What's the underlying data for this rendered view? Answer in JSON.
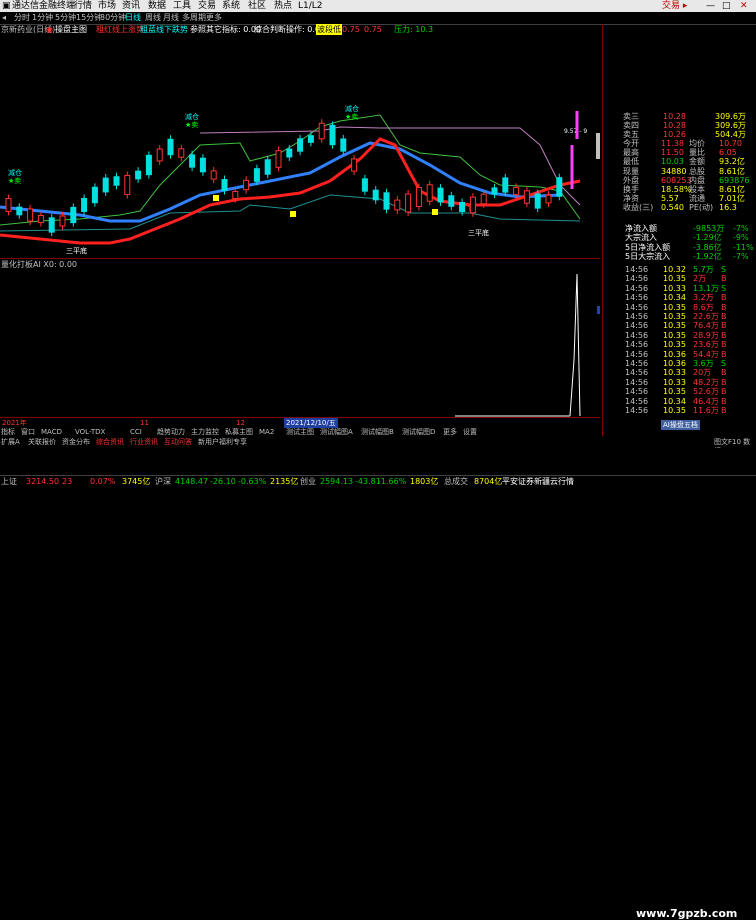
{
  "menu": {
    "app_title": "通达信金融终端",
    "items": [
      "行情",
      "市场",
      "资讯",
      "数据",
      "工具",
      "交易",
      "系统",
      "社区",
      "热点",
      "L1/L2"
    ],
    "broker": "交易 ▸"
  },
  "toolbar": {
    "periods": [
      "分时",
      "1分钟",
      "5分钟",
      "15分钟",
      "30分钟",
      "日线",
      "周线",
      "月线",
      "多周期",
      "更多"
    ]
  },
  "infobar": {
    "stock_name": "京新药业(日线)",
    "main_label": "操盘主图",
    "items": [
      "粗红线上涨势",
      "粗蓝线下跌势",
      "参照其它指标: 0.00",
      "综合判断操作: 0.00",
      "波段低",
      "0.75",
      "0.75",
      "压力: 10.3"
    ]
  },
  "chart": {
    "annotations": [
      "减仓",
      "★卖",
      "减仓",
      "★卖",
      "减仓",
      "★卖",
      "三平底",
      "三平底"
    ],
    "price_label": "9.57 - 9"
  },
  "indicator": {
    "label": "量化打板AI  X0: 0.00"
  },
  "quote": {
    "asks": [
      {
        "label": "卖三",
        "price": "10.28",
        "vol": "309.6万"
      },
      {
        "label": "卖四",
        "price": "10.28",
        "vol": "309.6万"
      },
      {
        "label": "卖五",
        "price": "10.26",
        "vol": "504.4万"
      }
    ],
    "stats": [
      {
        "l1": "今开",
        "v1": "11.38",
        "l2": "均价",
        "v2": "10.70"
      },
      {
        "l1": "最高",
        "v1": "11.50",
        "l2": "量比",
        "v2": "6.05"
      },
      {
        "l1": "最低",
        "v1": "10.03",
        "l2": "金额",
        "v2": "93.2亿"
      },
      {
        "l1": "现量",
        "v1": "34880",
        "l2": "总股",
        "v2": "8.61亿"
      },
      {
        "l1": "外盘",
        "v1": "608253",
        "l2": "内盘",
        "v2": "693876"
      },
      {
        "l1": "换手",
        "v1": "18.58%",
        "l2": "股本",
        "v2": "8.61亿"
      },
      {
        "l1": "净资",
        "v1": "5.57",
        "l2": "流通",
        "v2": "7.01亿"
      },
      {
        "l1": "收益(三)",
        "v1": "0.540",
        "l2": "PE(动)",
        "v2": "16.3"
      }
    ],
    "flows": [
      {
        "label": "净流入额",
        "value": "-9853万",
        "pct": "-7%"
      },
      {
        "label": "大宗流入",
        "value": "-1.29亿",
        "pct": "-9%"
      },
      {
        "label": "5日净流入额",
        "value": "-3.86亿",
        "pct": "-11%"
      },
      {
        "label": "5日大宗流入",
        "value": "-1.92亿",
        "pct": "-7%"
      }
    ],
    "ticks": [
      {
        "t": "14:56",
        "p": "10.32",
        "v": "5.7万",
        "d": "S"
      },
      {
        "t": "14:56",
        "p": "10.35",
        "v": "2万",
        "d": "B"
      },
      {
        "t": "14:56",
        "p": "10.33",
        "v": "13.1万",
        "d": "S"
      },
      {
        "t": "14:56",
        "p": "10.34",
        "v": "3.2万",
        "d": "B"
      },
      {
        "t": "14:56",
        "p": "10.35",
        "v": "8.6万",
        "d": "B"
      },
      {
        "t": "14:56",
        "p": "10.35",
        "v": "22.6万",
        "d": "B"
      },
      {
        "t": "14:56",
        "p": "10.35",
        "v": "76.4万",
        "d": "B"
      },
      {
        "t": "14:56",
        "p": "10.35",
        "v": "28.9万",
        "d": "B"
      },
      {
        "t": "14:56",
        "p": "10.35",
        "v": "23.6万",
        "d": "B"
      },
      {
        "t": "14:56",
        "p": "10.36",
        "v": "54.4万",
        "d": "B"
      },
      {
        "t": "14:56",
        "p": "10.36",
        "v": "3.6万",
        "d": "S"
      },
      {
        "t": "14:56",
        "p": "10.33",
        "v": "20万",
        "d": "B"
      },
      {
        "t": "14:56",
        "p": "10.33",
        "v": "48.2万",
        "d": "B"
      },
      {
        "t": "14:56",
        "p": "10.35",
        "v": "52.6万",
        "d": "B"
      },
      {
        "t": "14:56",
        "p": "10.34",
        "v": "46.4万",
        "d": "B"
      },
      {
        "t": "14:56",
        "p": "10.35",
        "v": "11.6万",
        "d": "B"
      }
    ],
    "panel_button": "AI操盘五档"
  },
  "axis": {
    "dates": [
      "2021年",
      "11",
      "12",
      "2021/12/10/五"
    ]
  },
  "tabs": {
    "row1": [
      "指标",
      "窗口",
      "MACD",
      "VOL-TDX",
      "CCI",
      "趋势动力",
      "主力监控",
      "私募主图",
      "MA2",
      "测试主图",
      "测试幅图A",
      "测试幅图B",
      "测试幅图D",
      "更多",
      "设置"
    ],
    "row2": [
      "扩展A",
      "关联报价",
      "资金分布",
      "综合资讯",
      "行业资讯",
      "互动问答",
      "新用户福利专享"
    ],
    "right_label": "图文F10 数据"
  },
  "status": {
    "items": [
      {
        "name": "上证",
        "value": "3214.50",
        "chg": "23",
        "pct": "0.07%",
        "amt": "3745亿"
      },
      {
        "name": "沪深",
        "value": "4148.47",
        "chg": "-26.10",
        "pct": "-0.63%",
        "amt": "2135亿"
      },
      {
        "name": "创业",
        "value": "2594.13",
        "chg": "-43.81",
        "pct": "-1.66%",
        "amt": "1803亿"
      }
    ],
    "total_label": "总成交",
    "total_value": "8704亿",
    "news": "平安证券新疆云行情"
  },
  "watermark": "www.7gpzb.com",
  "colors": {
    "up": "#ff3232",
    "down": "#00d000",
    "bg": "#000000",
    "axis": "#800000"
  }
}
